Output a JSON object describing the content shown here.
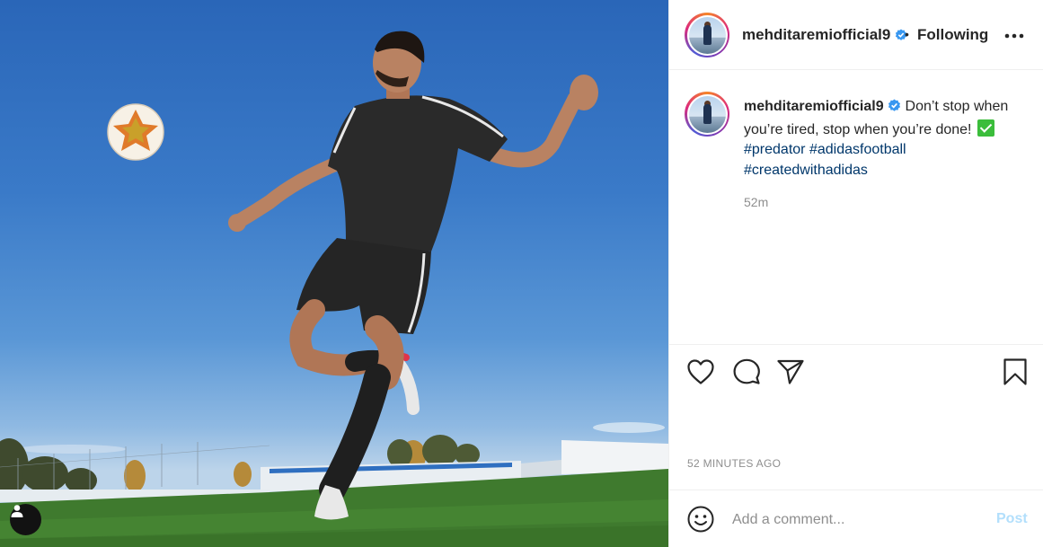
{
  "post": {
    "username": "mehditaremiofficial9",
    "dot": "•",
    "follow_status": "Following",
    "caption_text": "Don’t stop when you’re tired, stop when you’re done!",
    "hashtags": [
      "#predator",
      "#adidasfootball",
      "#createdwithadidas"
    ],
    "caption_time": "52m",
    "time_ago": "52 MINUTES AGO"
  },
  "comment": {
    "placeholder": "Add a comment...",
    "post_label": "Post"
  },
  "icons": {
    "verified": "verified-badge-icon",
    "more": "more-options-icon",
    "like": "heart-icon",
    "comment": "comment-bubble-icon",
    "share": "paper-plane-icon",
    "save": "bookmark-icon",
    "emoji": "emoji-smile-icon",
    "tag": "user-tag-icon"
  },
  "colors": {
    "verified": "#3897f0",
    "hashtag": "#00376b",
    "post_button_disabled": "#b2dffc",
    "secondary_text": "#8e8e8e",
    "check_emoji": "#3bbd3b"
  }
}
